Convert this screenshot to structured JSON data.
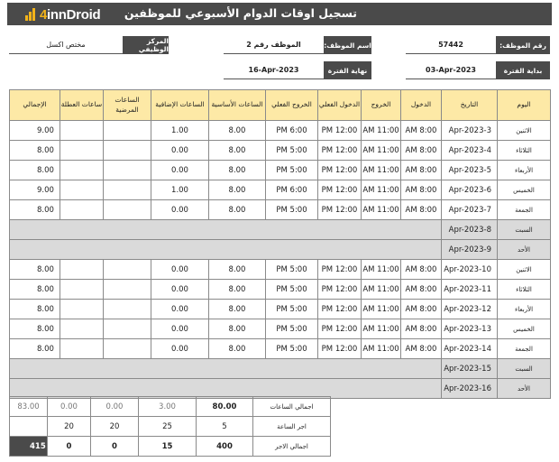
{
  "header": {
    "logo_prefix": "4",
    "logo_brand": "innDroid",
    "title": "تسجيل اوقات الدوام الأسبوعي للموظفين"
  },
  "info": {
    "employee_number_label": "رقم الموظف:",
    "employee_number": "57442",
    "employee_name_label": "اسم الموظف:",
    "employee_name": "الموظف رقم 2",
    "position_label": "المركز الوظيفي",
    "position": "مختص اكسل",
    "period_start_label": "بداية الفترة",
    "period_start": "03-Apr-2023",
    "period_end_label": "نهاية الفترة",
    "period_end": "16-Apr-2023"
  },
  "table": {
    "headers": [
      "اليوم",
      "التاريخ",
      "الدخول",
      "الخروج",
      "الدخول الفعلي",
      "الخروج الفعلي",
      "الساعات الأساسية",
      "الساعات الإضافية",
      "الساعات المرضية",
      "ساعات العطلة",
      "الإجمالي"
    ],
    "rows": [
      {
        "day": "الاثنين",
        "date": "3-Apr-2023",
        "in": "8:00 AM",
        "out": "11:00 AM",
        "actual_in": "12:00 PM",
        "actual_out": "6:00 PM",
        "basic": "8.00",
        "overtime": "1.00",
        "sick": "",
        "holiday": "",
        "total": "9.00",
        "weekend": false
      },
      {
        "day": "الثلاثاء",
        "date": "4-Apr-2023",
        "in": "8:00 AM",
        "out": "11:00 AM",
        "actual_in": "12:00 PM",
        "actual_out": "5:00 PM",
        "basic": "8.00",
        "overtime": "0.00",
        "sick": "",
        "holiday": "",
        "total": "8.00",
        "weekend": false
      },
      {
        "day": "الأربعاء",
        "date": "5-Apr-2023",
        "in": "8:00 AM",
        "out": "11:00 AM",
        "actual_in": "12:00 PM",
        "actual_out": "5:00 PM",
        "basic": "8.00",
        "overtime": "0.00",
        "sick": "",
        "holiday": "",
        "total": "8.00",
        "weekend": false
      },
      {
        "day": "الخميس",
        "date": "6-Apr-2023",
        "in": "8:00 AM",
        "out": "11:00 AM",
        "actual_in": "12:00 PM",
        "actual_out": "6:00 PM",
        "basic": "8.00",
        "overtime": "1.00",
        "sick": "",
        "holiday": "",
        "total": "9.00",
        "weekend": false
      },
      {
        "day": "الجمعة",
        "date": "7-Apr-2023",
        "in": "8:00 AM",
        "out": "11:00 AM",
        "actual_in": "12:00 PM",
        "actual_out": "5:00 PM",
        "basic": "8.00",
        "overtime": "0.00",
        "sick": "",
        "holiday": "",
        "total": "8.00",
        "weekend": false
      },
      {
        "day": "السبت",
        "date": "8-Apr-2023",
        "weekend": true
      },
      {
        "day": "الأحد",
        "date": "9-Apr-2023",
        "weekend": true
      },
      {
        "day": "الاثنين",
        "date": "10-Apr-2023",
        "in": "8:00 AM",
        "out": "11:00 AM",
        "actual_in": "12:00 PM",
        "actual_out": "5:00 PM",
        "basic": "8.00",
        "overtime": "0.00",
        "sick": "",
        "holiday": "",
        "total": "8.00",
        "weekend": false
      },
      {
        "day": "الثلاثاء",
        "date": "11-Apr-2023",
        "in": "8:00 AM",
        "out": "11:00 AM",
        "actual_in": "12:00 PM",
        "actual_out": "5:00 PM",
        "basic": "8.00",
        "overtime": "0.00",
        "sick": "",
        "holiday": "",
        "total": "8.00",
        "weekend": false
      },
      {
        "day": "الأربعاء",
        "date": "12-Apr-2023",
        "in": "8:00 AM",
        "out": "11:00 AM",
        "actual_in": "12:00 PM",
        "actual_out": "5:00 PM",
        "basic": "8.00",
        "overtime": "0.00",
        "sick": "",
        "holiday": "",
        "total": "8.00",
        "weekend": false
      },
      {
        "day": "الخميس",
        "date": "13-Apr-2023",
        "in": "8:00 AM",
        "out": "11:00 AM",
        "actual_in": "12:00 PM",
        "actual_out": "5:00 PM",
        "basic": "8.00",
        "overtime": "0.00",
        "sick": "",
        "holiday": "",
        "total": "8.00",
        "weekend": false
      },
      {
        "day": "الجمعة",
        "date": "14-Apr-2023",
        "in": "8:00 AM",
        "out": "11:00 AM",
        "actual_in": "12:00 PM",
        "actual_out": "5:00 PM",
        "basic": "8.00",
        "overtime": "0.00",
        "sick": "",
        "holiday": "",
        "total": "8.00",
        "weekend": false
      },
      {
        "day": "السبت",
        "date": "15-Apr-2023",
        "weekend": true
      },
      {
        "day": "الأحد",
        "date": "16-Apr-2023",
        "weekend": true
      }
    ]
  },
  "summary": {
    "rows": [
      {
        "label": "اجمالي الساعات",
        "basic": "80.00",
        "overtime": "3.00",
        "sick": "0.00",
        "holiday": "0.00",
        "total": "83.00"
      },
      {
        "label": "اجر الساعة",
        "basic": "5",
        "overtime": "25",
        "sick": "20",
        "holiday": "20",
        "total": ""
      },
      {
        "label": "اجمالي الاجر",
        "basic": "400",
        "overtime": "15",
        "sick": "0",
        "holiday": "0",
        "total": "415"
      }
    ]
  }
}
